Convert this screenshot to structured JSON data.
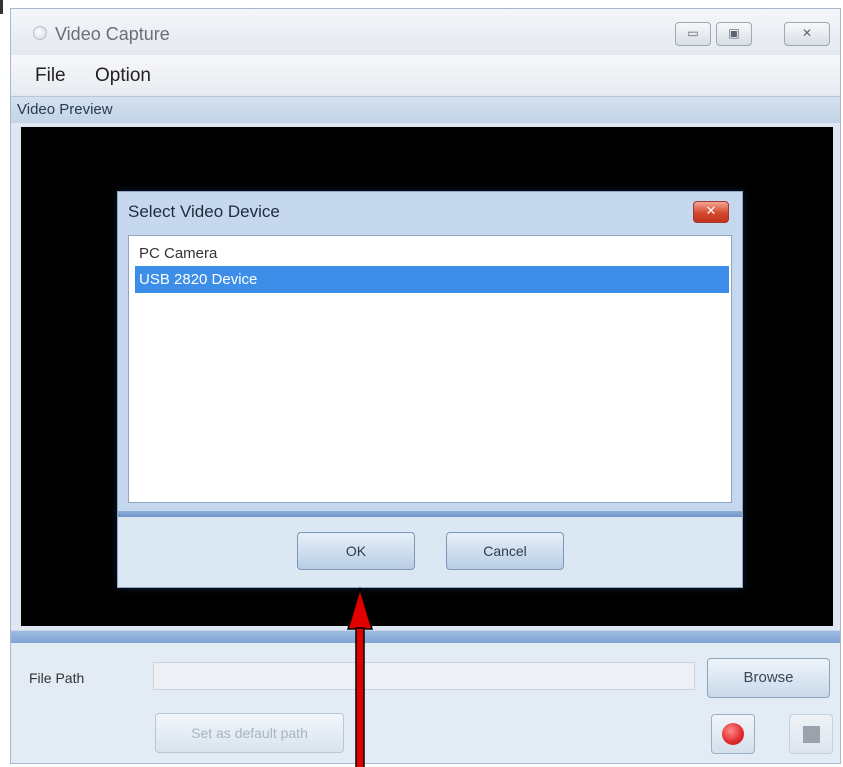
{
  "window": {
    "title": "Video Capture",
    "controls": {
      "minimize": "▭",
      "maximize": "▣",
      "close": "✕"
    }
  },
  "menu": {
    "items": [
      "File",
      "Option"
    ]
  },
  "preview": {
    "label": "Video Preview"
  },
  "dialog": {
    "title": "Select Video Device",
    "close_glyph": "✕",
    "devices": [
      "PC Camera",
      "USB 2820 Device"
    ],
    "selected_index": 1,
    "ok_label": "OK",
    "cancel_label": "Cancel"
  },
  "bottom": {
    "file_path_label": "File Path",
    "file_path_value": "",
    "browse_label": "Browse",
    "default_path_label": "Set as default path"
  },
  "colors": {
    "selection": "#3d8ee8",
    "record": "#e0292c",
    "annotation_arrow": "#e00000"
  },
  "icons": [
    "app-icon",
    "minimize-icon",
    "maximize-icon",
    "close-icon",
    "record-icon",
    "stop-icon",
    "arrow-annotation-icon"
  ]
}
